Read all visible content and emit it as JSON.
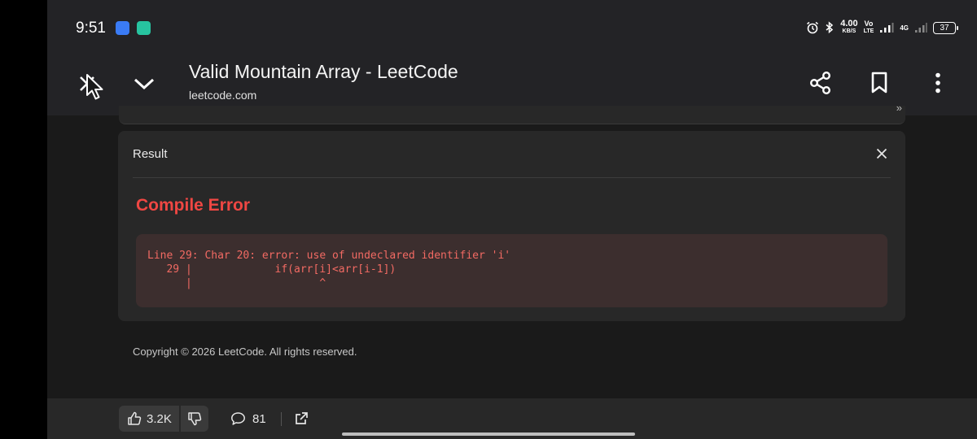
{
  "status_bar": {
    "time": "9:51",
    "net_speed_top": "4.00",
    "net_speed_bottom": "KB/S",
    "volte_top": "Vo",
    "volte_bottom": "LTE",
    "network_type": "4G",
    "battery": "37"
  },
  "toolbar": {
    "title": "Valid Mountain Array - LeetCode",
    "domain": "leetcode.com"
  },
  "result": {
    "label": "Result",
    "status": "Compile Error",
    "error_lines": [
      "Line 29: Char 20: error: use of undeclared identifier 'i'",
      "   29 |             if(arr[i]<arr[i-1])",
      "      |                    ^"
    ]
  },
  "footer": {
    "copyright": "Copyright © 2026 LeetCode. All rights reserved."
  },
  "bottom_bar": {
    "likes": "3.2K",
    "comments": "81"
  },
  "colors": {
    "accent_error": "#ef4743",
    "background": "#1a1a1a",
    "card": "#282828"
  },
  "icons": [
    "alarm-icon",
    "bluetooth-icon",
    "signal-icon",
    "battery-icon",
    "close-icon",
    "chevron-down-icon",
    "share-icon",
    "bookmark-icon",
    "more-vert-icon",
    "thumbs-up-icon",
    "thumbs-down-icon",
    "comment-icon",
    "external-link-icon",
    "mouse-cursor-icon"
  ]
}
